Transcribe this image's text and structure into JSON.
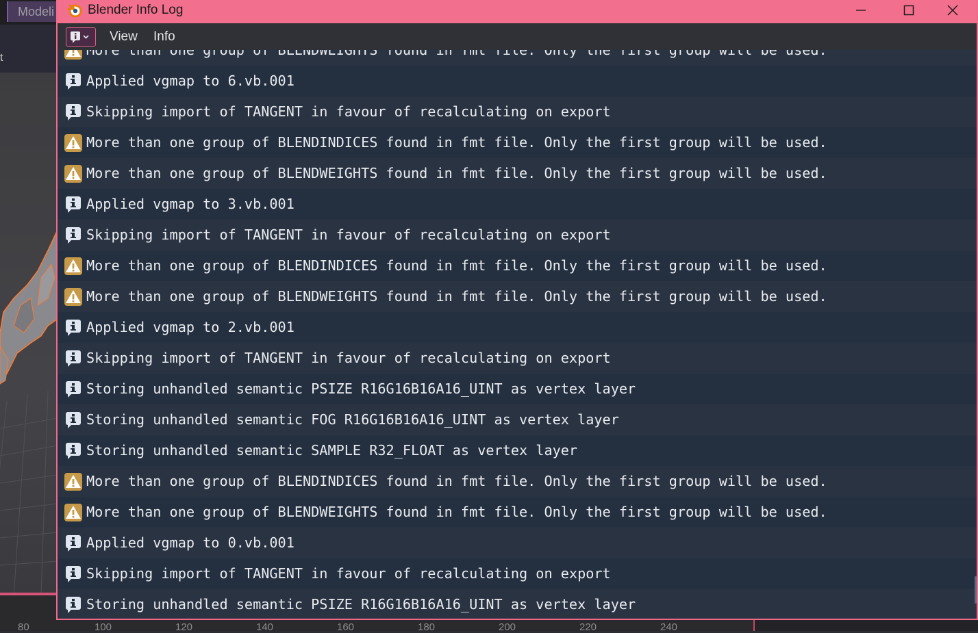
{
  "background": {
    "workspace_tab": "Modeli",
    "side_label": "t",
    "ruler_ticks": [
      "80",
      "100",
      "120",
      "140",
      "160",
      "180",
      "200",
      "220",
      "240"
    ]
  },
  "window": {
    "title": "Blender Info Log",
    "accent_color": "#f26f8d",
    "controls": [
      "minimize-icon",
      "maximize-icon",
      "close-icon"
    ]
  },
  "menubar": {
    "editor_type_icon": "info-icon",
    "items": [
      {
        "label": "View"
      },
      {
        "label": "Info"
      }
    ]
  },
  "log": {
    "entries": [
      {
        "type": "warning",
        "icon": "warning-icon",
        "text": "More than one group of BLENDWEIGHTS found in fmt file. Only the first group will be used."
      },
      {
        "type": "info",
        "icon": "info-icon",
        "text": "Applied vgmap to 6.vb.001"
      },
      {
        "type": "info",
        "icon": "info-icon",
        "text": "Skipping import of TANGENT in favour of recalculating on export"
      },
      {
        "type": "warning",
        "icon": "warning-icon",
        "text": "More than one group of BLENDINDICES found in fmt file. Only the first group will be used."
      },
      {
        "type": "warning",
        "icon": "warning-icon",
        "text": "More than one group of BLENDWEIGHTS found in fmt file. Only the first group will be used."
      },
      {
        "type": "info",
        "icon": "info-icon",
        "text": "Applied vgmap to 3.vb.001"
      },
      {
        "type": "info",
        "icon": "info-icon",
        "text": "Skipping import of TANGENT in favour of recalculating on export"
      },
      {
        "type": "warning",
        "icon": "warning-icon",
        "text": "More than one group of BLENDINDICES found in fmt file. Only the first group will be used."
      },
      {
        "type": "warning",
        "icon": "warning-icon",
        "text": "More than one group of BLENDWEIGHTS found in fmt file. Only the first group will be used."
      },
      {
        "type": "info",
        "icon": "info-icon",
        "text": "Applied vgmap to 2.vb.001"
      },
      {
        "type": "info",
        "icon": "info-icon",
        "text": "Skipping import of TANGENT in favour of recalculating on export"
      },
      {
        "type": "info",
        "icon": "info-icon",
        "text": "Storing unhandled semantic PSIZE R16G16B16A16_UINT as vertex layer"
      },
      {
        "type": "info",
        "icon": "info-icon",
        "text": "Storing unhandled semantic FOG R16G16B16A16_UINT as vertex layer"
      },
      {
        "type": "info",
        "icon": "info-icon",
        "text": "Storing unhandled semantic SAMPLE R32_FLOAT as vertex layer"
      },
      {
        "type": "warning",
        "icon": "warning-icon",
        "text": "More than one group of BLENDINDICES found in fmt file. Only the first group will be used."
      },
      {
        "type": "warning",
        "icon": "warning-icon",
        "text": "More than one group of BLENDWEIGHTS found in fmt file. Only the first group will be used."
      },
      {
        "type": "info",
        "icon": "info-icon",
        "text": "Applied vgmap to 0.vb.001"
      },
      {
        "type": "info",
        "icon": "info-icon",
        "text": "Skipping import of TANGENT in favour of recalculating on export"
      },
      {
        "type": "info",
        "icon": "info-icon",
        "text": "Storing unhandled semantic PSIZE R16G16B16A16_UINT as vertex layer"
      }
    ],
    "colors": {
      "info_icon_bg": "#dfe6ef",
      "info_icon_fg": "#1e2a3a",
      "warning_icon_bg": "#c79a4a",
      "warning_icon_fg": "#ffffff",
      "text": "#e9ecf0"
    }
  }
}
